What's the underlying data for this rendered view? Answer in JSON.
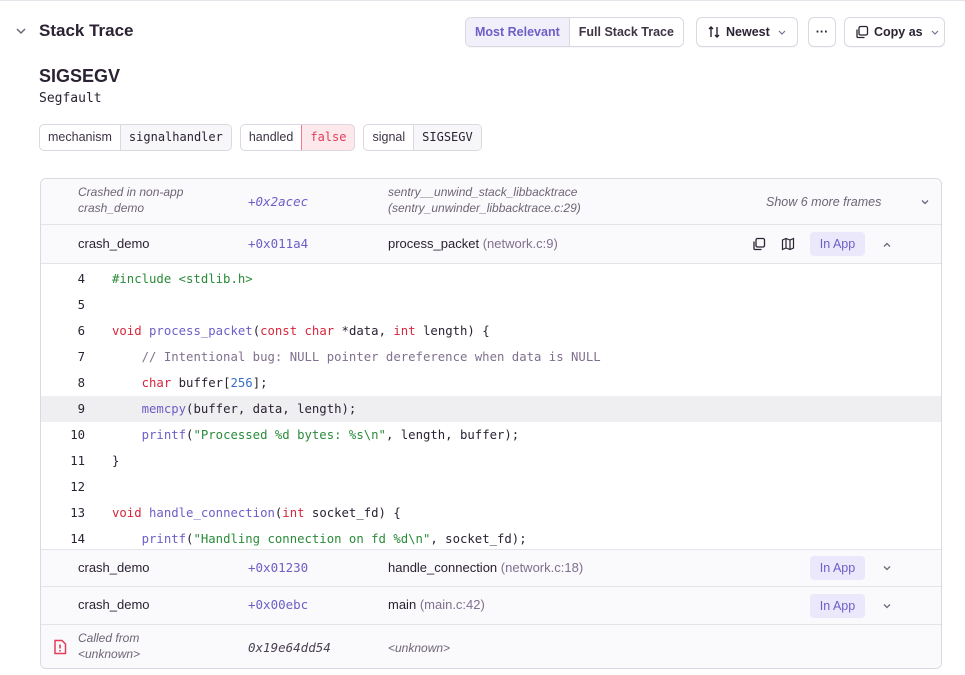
{
  "header": {
    "title": "Stack Trace",
    "view_tabs": [
      "Most Relevant",
      "Full Stack Trace"
    ],
    "sort_label": "Newest",
    "more_label": "···",
    "copy_label": "Copy as"
  },
  "exception": {
    "type": "SIGSEGV",
    "value": "Segfault"
  },
  "tags": [
    {
      "key": "mechanism",
      "value": "signalhandler"
    },
    {
      "key": "handled",
      "value": "false"
    },
    {
      "key": "signal",
      "value": "SIGSEGV"
    }
  ],
  "frames": {
    "nonapp": {
      "label_line1": "Crashed in non-app",
      "label_line2": "crash_demo",
      "address": "+0x2acec",
      "function_line1": "sentry__unwind_stack_libbacktrace",
      "function_line2": "(sentry_unwinder_libbacktrace.c:29)",
      "more": "Show 6 more frames"
    },
    "expanded": {
      "package": "crash_demo",
      "address": "+0x011a4",
      "function": "process_packet",
      "location": "(network.c:9)",
      "badge": "In App"
    },
    "code": {
      "lines": [
        {
          "n": "4"
        },
        {
          "n": "5"
        },
        {
          "n": "6"
        },
        {
          "n": "7"
        },
        {
          "n": "8"
        },
        {
          "n": "9"
        },
        {
          "n": "10"
        },
        {
          "n": "11"
        },
        {
          "n": "12"
        },
        {
          "n": "13"
        },
        {
          "n": "14"
        }
      ]
    },
    "frame2": {
      "package": "crash_demo",
      "address": "+0x01230",
      "function": "handle_connection",
      "location": "(network.c:18)",
      "badge": "In App"
    },
    "frame3": {
      "package": "crash_demo",
      "address": "+0x00ebc",
      "function": "main",
      "location": "(main.c:42)",
      "badge": "In App"
    },
    "called_from": {
      "label_line1": "Called from",
      "label_line2": "<unknown>",
      "address": "0x19e64dd54",
      "function": "<unknown>"
    }
  },
  "colors": {
    "accent": "#6c5fc7",
    "danger": "#e03e5a",
    "keyword": "#d6273d",
    "string": "#2a8b3a"
  }
}
